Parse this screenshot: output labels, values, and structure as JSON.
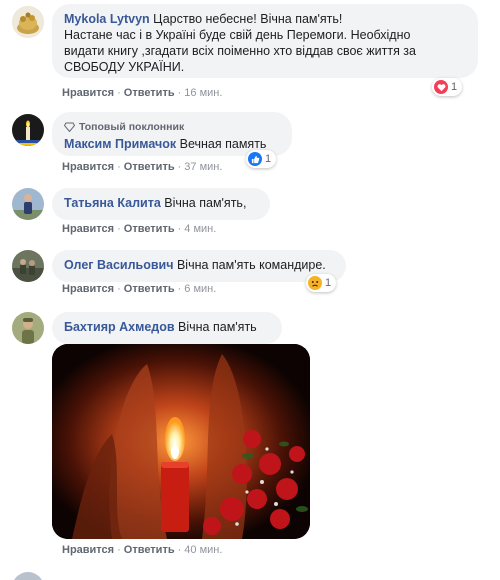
{
  "comments": [
    {
      "author": "Mykola Lytvyn",
      "text": "Царство небесне! Вічна пам'ять!",
      "text_lines": [
        "Настане час і в Україні буде свій день Перемоги. Необхідно",
        "видати книгу ,згадати всіх поіменно хто віддав своє життя за",
        "СВОБОДУ УКРАЇНИ."
      ],
      "like_label": "Нравится",
      "reply_label": "Ответить",
      "time": "16 мин.",
      "reaction_icon": "heart-icon",
      "reaction_count": "1"
    },
    {
      "badge": "Топовый поклонник",
      "author": "Максим Примачок",
      "text": "Вечная память",
      "like_label": "Нравится",
      "reply_label": "Ответить",
      "time": "37 мин.",
      "reaction_icon": "thumbs-up-icon",
      "reaction_count": "1"
    },
    {
      "author": "Татьяна Калита",
      "text": "Вічна пам'ять,",
      "like_label": "Нравится",
      "reply_label": "Ответить",
      "time": "4 мин."
    },
    {
      "author": "Олег Васильович",
      "text": "Вічна пам'ять командире.",
      "like_label": "Нравится",
      "reply_label": "Ответить",
      "time": "6 мин.",
      "reaction_icon": "sad-face-icon",
      "reaction_count": "1"
    },
    {
      "author": "Бахтияр Ахмедов",
      "text": "Вічна пам'ять",
      "like_label": "Нравится",
      "reply_label": "Ответить",
      "time": "40 мин."
    }
  ],
  "colors": {
    "author": "#385898",
    "bubble": "#f2f3f5",
    "meta": "#606770",
    "like_blue": "#1877f2",
    "heart_red": "#f33e58",
    "sad_yellow": "#f7b125"
  },
  "separator": "·"
}
